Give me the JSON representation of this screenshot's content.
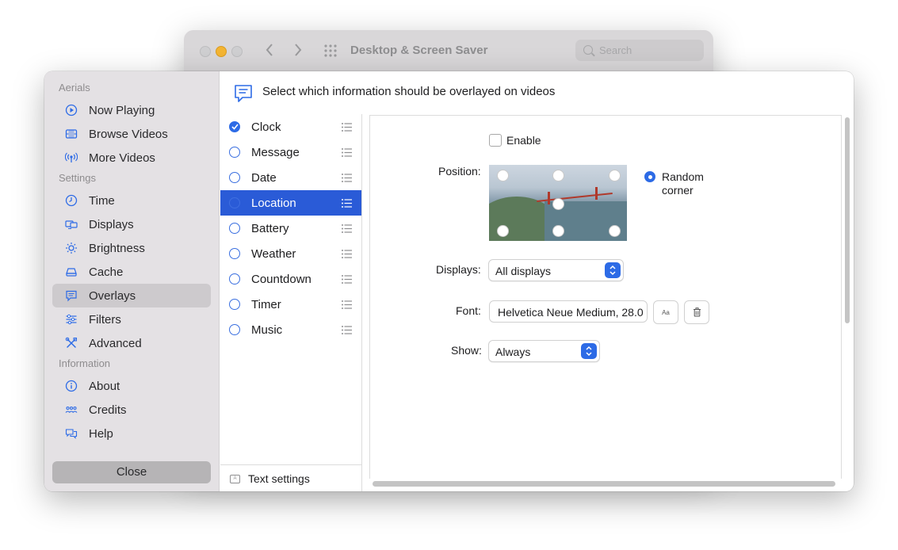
{
  "background_window": {
    "title": "Desktop & Screen Saver",
    "search_placeholder": "Search"
  },
  "header": {
    "text": "Select which information should be overlayed on videos"
  },
  "sidebar": {
    "sections": [
      {
        "title": "Aerials",
        "items": [
          {
            "label": "Now Playing",
            "icon": "play-circle-icon"
          },
          {
            "label": "Browse Videos",
            "icon": "film-icon"
          },
          {
            "label": "More Videos",
            "icon": "antenna-icon"
          }
        ]
      },
      {
        "title": "Settings",
        "items": [
          {
            "label": "Time",
            "icon": "clock-icon"
          },
          {
            "label": "Displays",
            "icon": "displays-icon"
          },
          {
            "label": "Brightness",
            "icon": "sun-icon"
          },
          {
            "label": "Cache",
            "icon": "drive-icon"
          },
          {
            "label": "Overlays",
            "icon": "speech-bubble-icon",
            "selected": true
          },
          {
            "label": "Filters",
            "icon": "sliders-icon"
          },
          {
            "label": "Advanced",
            "icon": "tools-icon"
          }
        ]
      },
      {
        "title": "Information",
        "items": [
          {
            "label": "About",
            "icon": "info-icon"
          },
          {
            "label": "Credits",
            "icon": "people-icon"
          },
          {
            "label": "Help",
            "icon": "help-bubble-icon"
          }
        ]
      }
    ],
    "close_label": "Close"
  },
  "overlay_list": {
    "items": [
      {
        "label": "Clock",
        "checked": true
      },
      {
        "label": "Message",
        "checked": false
      },
      {
        "label": "Date",
        "checked": false
      },
      {
        "label": "Location",
        "checked": false,
        "selected": true
      },
      {
        "label": "Battery",
        "checked": false
      },
      {
        "label": "Weather",
        "checked": false
      },
      {
        "label": "Countdown",
        "checked": false
      },
      {
        "label": "Timer",
        "checked": false
      },
      {
        "label": "Music",
        "checked": false
      }
    ],
    "text_settings_label": "Text settings",
    "text_settings_icon_text": "A"
  },
  "settings": {
    "enable_label": "Enable",
    "enable_checked": false,
    "position_label": "Position:",
    "random_corner_line1": "Random",
    "random_corner_line2": "corner",
    "displays_label": "Displays:",
    "displays_value": "All displays",
    "font_label": "Font:",
    "font_value": "Helvetica Neue Medium, 28.0",
    "font_button_label": "Aa",
    "show_label": "Show:",
    "show_value": "Always"
  },
  "colors": {
    "accent": "#2d6be6",
    "selection": "#2a5bd7",
    "sidebar_bg": "#e4e1e4"
  }
}
